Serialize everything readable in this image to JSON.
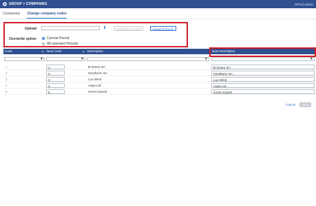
{
  "header": {
    "title": "GROUP > COMPANIES",
    "user": "OPbcd admin"
  },
  "tabs": [
    {
      "label": "Companies",
      "active": false
    },
    {
      "label": "Change company codes",
      "active": true
    }
  ],
  "upload": {
    "label": "Upload",
    "value": "",
    "import_label": "Import from Excel",
    "export_label": "Export to Excel"
  },
  "overwrite": {
    "label": "Overwrite option",
    "options": [
      {
        "label": "Current Period",
        "checked": true
      },
      {
        "label": "All unlocked Periods",
        "checked": false
      }
    ]
  },
  "table": {
    "columns": [
      "Code",
      "New Code",
      "Description",
      "New Description"
    ],
    "rows": [
      {
        "code": "1",
        "new_code": "1",
        "description": "B-Green SA",
        "new_description": "B-Green SA"
      },
      {
        "code": "2",
        "new_code": "2",
        "description": "Geotherm SA",
        "new_description": "Geotherm SA"
      },
      {
        "code": "3",
        "new_code": "3",
        "description": "Lux Wind",
        "new_description": "Lux Wind"
      },
      {
        "code": "4",
        "new_code": "4",
        "description": "Aqua Ltd",
        "new_description": "Aqua Ltd"
      },
      {
        "code": "5",
        "new_code": "5",
        "description": "Green Export",
        "new_description": "Green Export"
      }
    ]
  },
  "footer": {
    "cancel_label": "Cancel",
    "save_label": "Save"
  },
  "colors": {
    "header_bg": "#2f4f8f",
    "accent": "#2f6fd0",
    "highlight": "#d11a2a"
  }
}
